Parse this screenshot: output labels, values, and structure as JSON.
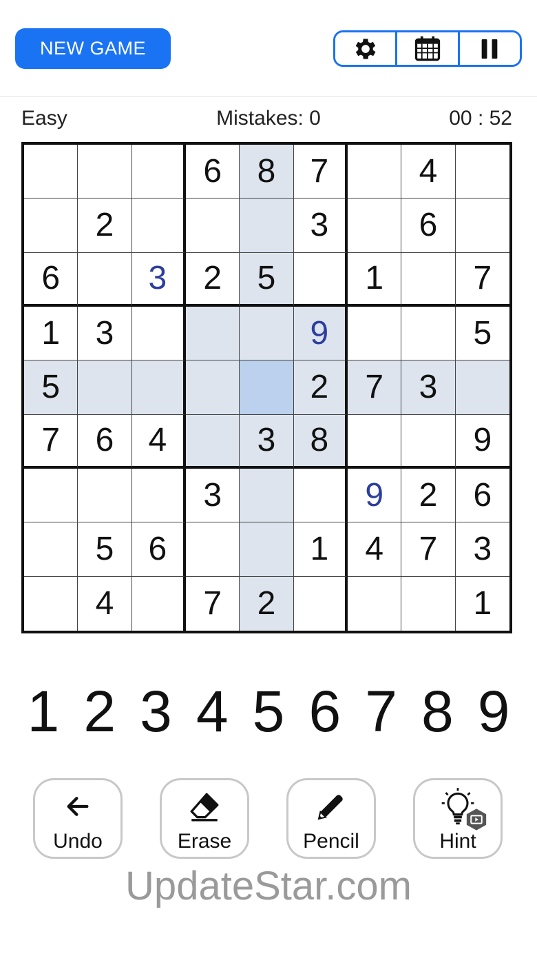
{
  "header": {
    "new_game_label": "NEW GAME",
    "toolbar": {
      "settings_icon": "gear-icon",
      "calendar_icon": "calendar-icon",
      "pause_icon": "pause-icon"
    }
  },
  "status": {
    "difficulty": "Easy",
    "mistakes": "Mistakes: 0",
    "timer": "00 : 52"
  },
  "board": {
    "selected": [
      4,
      4
    ],
    "highlighted": [
      [
        0,
        4
      ],
      [
        1,
        4
      ],
      [
        2,
        4
      ],
      [
        3,
        4
      ],
      [
        5,
        4
      ],
      [
        6,
        4
      ],
      [
        7,
        4
      ],
      [
        8,
        4
      ],
      [
        4,
        0
      ],
      [
        4,
        1
      ],
      [
        4,
        2
      ],
      [
        4,
        3
      ],
      [
        4,
        5
      ],
      [
        4,
        6
      ],
      [
        4,
        7
      ],
      [
        4,
        8
      ],
      [
        3,
        3
      ],
      [
        3,
        5
      ],
      [
        5,
        3
      ],
      [
        5,
        5
      ]
    ],
    "user_entered": [
      [
        2,
        2
      ],
      [
        3,
        5
      ],
      [
        6,
        6
      ]
    ],
    "grid": [
      [
        "",
        "",
        "",
        "6",
        "8",
        "7",
        "",
        "4",
        ""
      ],
      [
        "",
        "2",
        "",
        "",
        "",
        "3",
        "",
        "6",
        ""
      ],
      [
        "6",
        "",
        "3",
        "2",
        "5",
        "",
        "1",
        "",
        "7"
      ],
      [
        "1",
        "3",
        "",
        "",
        "",
        "9",
        "",
        "",
        "5"
      ],
      [
        "5",
        "",
        "",
        "",
        "",
        "2",
        "7",
        "3",
        ""
      ],
      [
        "7",
        "6",
        "4",
        "",
        "3",
        "8",
        "",
        "",
        "9"
      ],
      [
        "",
        "",
        "",
        "3",
        "",
        "",
        "9",
        "2",
        "6"
      ],
      [
        "",
        "5",
        "6",
        "",
        "",
        "1",
        "4",
        "7",
        "3"
      ],
      [
        "",
        "4",
        "",
        "7",
        "2",
        "",
        "",
        "",
        "1"
      ]
    ],
    "colors": {
      "highlight": "#dde4ee",
      "selected": "#bcd1ee",
      "user_digit": "#2c3e9e"
    }
  },
  "numpad": [
    "1",
    "2",
    "3",
    "4",
    "5",
    "6",
    "7",
    "8",
    "9"
  ],
  "actions": {
    "undo": {
      "label": "Undo",
      "icon": "arrow-left-icon"
    },
    "erase": {
      "label": "Erase",
      "icon": "eraser-icon"
    },
    "pencil": {
      "label": "Pencil",
      "icon": "pencil-icon"
    },
    "hint": {
      "label": "Hint",
      "icon": "lightbulb-icon",
      "badge_icon": "video-ad-icon"
    }
  },
  "watermark": "UpdateStar.com",
  "accent_color": "#1a73f2"
}
